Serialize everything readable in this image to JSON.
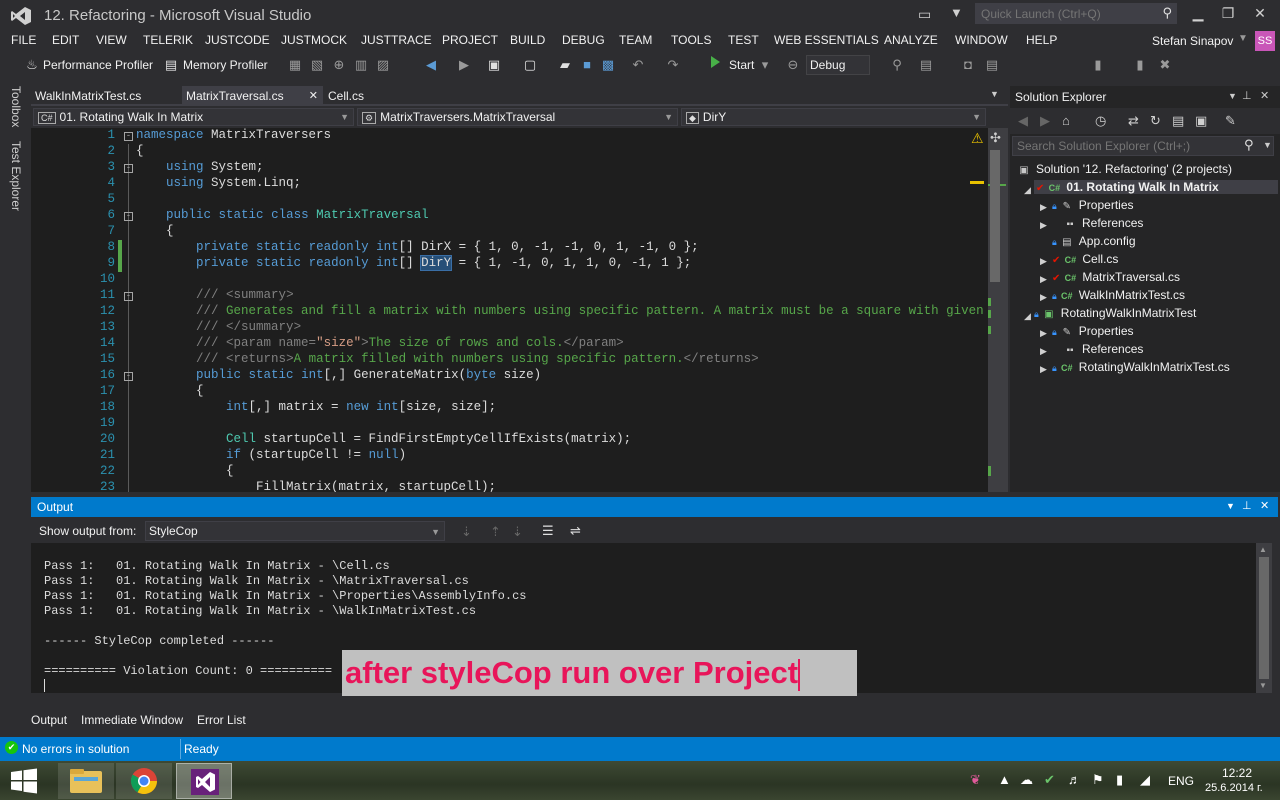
{
  "window": {
    "title": "12. Refactoring - Microsoft Visual Studio",
    "quick_launch_placeholder": "Quick Launch (Ctrl+Q)"
  },
  "menu": [
    "FILE",
    "EDIT",
    "VIEW",
    "TELERIK",
    "JUSTCODE",
    "JUSTMOCK",
    "JUSTTRACE",
    "PROJECT",
    "BUILD",
    "DEBUG",
    "TEAM",
    "TOOLS",
    "TEST",
    "WEB ESSENTIALS",
    "ANALYZE",
    "WINDOW",
    "HELP"
  ],
  "user": {
    "name": "Stefan Sinapov",
    "initials": "SS"
  },
  "toolbar": {
    "performance_profiler": "Performance Profiler",
    "memory_profiler": "Memory Profiler",
    "start": "Start",
    "config": "Debug"
  },
  "side_tabs": [
    "Toolbox",
    "Test Explorer"
  ],
  "doc_tabs": [
    {
      "label": "WalkInMatrixTest.cs",
      "active": false
    },
    {
      "label": "MatrixTraversal.cs",
      "active": true
    },
    {
      "label": "Cell.cs",
      "active": false
    }
  ],
  "navbar": {
    "project": "01. Rotating Walk In Matrix",
    "type": "MatrixTraversers.MatrixTraversal",
    "member": "DirY"
  },
  "code_lines": [
    {
      "n": "1",
      "text": "namespace MatrixTraversers"
    },
    {
      "n": "2",
      "text": "{"
    },
    {
      "n": "3",
      "text": "    using System;"
    },
    {
      "n": "4",
      "text": "    using System.Linq;"
    },
    {
      "n": "5",
      "text": ""
    },
    {
      "n": "6",
      "text": "    public static class MatrixTraversal"
    },
    {
      "n": "7",
      "text": "    {"
    },
    {
      "n": "8",
      "text": "        private static readonly int[] DirX = { 1, 0, -1, -1, 0, 1, -1, 0 };"
    },
    {
      "n": "9",
      "text": "        private static readonly int[] DirY = { 1, -1, 0, 1, 1, 0, -1, 1 };"
    },
    {
      "n": "10",
      "text": ""
    },
    {
      "n": "11",
      "text": "        /// <summary>"
    },
    {
      "n": "12",
      "text": "        /// Generates and fill a matrix with numbers using specific pattern. A matrix must be a square with given size."
    },
    {
      "n": "13",
      "text": "        /// </summary>"
    },
    {
      "n": "14",
      "text": "        /// <param name=\"size\">The size of rows and cols.</param>"
    },
    {
      "n": "15",
      "text": "        /// <returns>A matrix filled with numbers using specific pattern.</returns>"
    },
    {
      "n": "16",
      "text": "        public static int[,] GenerateMatrix(byte size)"
    },
    {
      "n": "17",
      "text": "        {"
    },
    {
      "n": "18",
      "text": "            int[,] matrix = new int[size, size];"
    },
    {
      "n": "19",
      "text": ""
    },
    {
      "n": "20",
      "text": "            Cell startupCell = FindFirstEmptyCellIfExists(matrix);"
    },
    {
      "n": "21",
      "text": "            if (startupCell != null)"
    },
    {
      "n": "22",
      "text": "            {"
    },
    {
      "n": "23",
      "text": "                FillMatrix(matrix, startupCell);"
    }
  ],
  "solution_explorer": {
    "title": "Solution Explorer",
    "search_placeholder": "Search Solution Explorer (Ctrl+;)",
    "solution": "Solution '12. Refactoring' (2 projects)",
    "project1": "01. Rotating Walk In Matrix",
    "project1_items": [
      "Properties",
      "References",
      "App.config",
      "Cell.cs",
      "MatrixTraversal.cs",
      "WalkInMatrixTest.cs"
    ],
    "project2": "RotatingWalkInMatrixTest",
    "project2_items": [
      "Properties",
      "References",
      "RotatingWalkInMatrixTest.cs"
    ]
  },
  "output": {
    "title": "Output",
    "show_from_label": "Show output from:",
    "source": "StyleCop",
    "lines": [
      "Pass 1:   01. Rotating Walk In Matrix - \\Cell.cs",
      "Pass 1:   01. Rotating Walk In Matrix - \\MatrixTraversal.cs",
      "Pass 1:   01. Rotating Walk In Matrix - \\Properties\\AssemblyInfo.cs",
      "Pass 1:   01. Rotating Walk In Matrix - \\WalkInMatrixTest.cs",
      "",
      "------ StyleCop completed ------",
      "",
      "========== Violation Count: 0 =========="
    ],
    "caption": "after styleCop run over Project"
  },
  "bottom_tabs": [
    "Output",
    "Immediate Window",
    "Error List"
  ],
  "status": {
    "message": "No errors in solution",
    "state": "Ready"
  },
  "taskbar": {
    "lang": "ENG",
    "time": "12:22",
    "date": "25.6.2014 г."
  },
  "colors": {
    "accent": "#007acc",
    "vs_purple": "#68217a",
    "caption_text": "#e8155a"
  }
}
